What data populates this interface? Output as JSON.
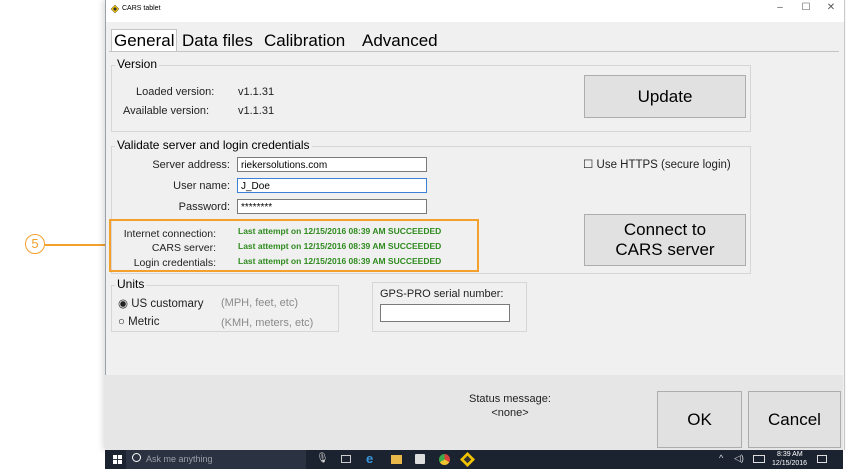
{
  "window": {
    "title": "CARS tablet",
    "controls": [
      "–",
      "☐",
      "✕"
    ]
  },
  "tabs": [
    "General",
    "Data files",
    "Calibration",
    "Advanced"
  ],
  "version": {
    "group_title": "Version",
    "loaded_label": "Loaded version:",
    "loaded_value": "v1.1.31",
    "available_label": "Available version:",
    "available_value": "v1.1.31",
    "update_button": "Update"
  },
  "credentials": {
    "group_title": "Validate server and login credentials",
    "server_label": "Server address:",
    "server_value": "riekersolutions.com",
    "user_label": "User name:",
    "user_value": "J_Doe",
    "password_label": "Password:",
    "password_value": "********",
    "https_checkbox": "Use HTTPS (secure login)",
    "connect_button_line1": "Connect to",
    "connect_button_line2": "CARS server",
    "internet_label": "Internet connection:",
    "internet_status": "Last attempt on 12/15/2016 08:39 AM SUCCEEDED",
    "cars_label": "CARS server:",
    "cars_status": "Last attempt on 12/15/2016 08:39 AM SUCCEEDED",
    "login_label": "Login credentials:",
    "login_status": "Last attempt on 12/15/2016 08:39 AM SUCCEEDED"
  },
  "units": {
    "group_title": "Units",
    "us_label": "US customary",
    "us_hint": "(MPH, feet, etc)",
    "metric_label": "Metric",
    "metric_hint": "(KMH, meters, etc)"
  },
  "gps": {
    "label": "GPS-PRO serial number:",
    "value": ""
  },
  "status": {
    "label": "Status message:",
    "value": "<none>"
  },
  "buttons": {
    "ok": "OK",
    "cancel": "Cancel"
  },
  "callout": {
    "number": "5"
  },
  "taskbar": {
    "search_placeholder": "Ask me anything",
    "time": "8:39 AM",
    "date": "12/15/2016"
  },
  "colors": {
    "success": "#2e8b1e",
    "highlight": "#f3a02d",
    "taskbar": "#1b2230"
  }
}
